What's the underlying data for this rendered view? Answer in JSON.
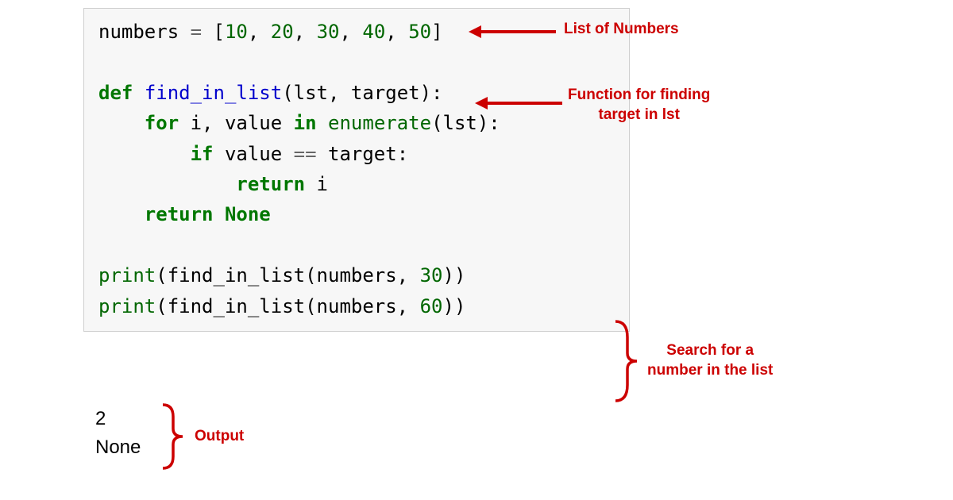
{
  "code": {
    "l1_var": "numbers ",
    "l1_eq": "= ",
    "l1_br_open": "[",
    "l1_n1": "10",
    "l1_c1": ", ",
    "l1_n2": "20",
    "l1_c2": ", ",
    "l1_n3": "30",
    "l1_c3": ", ",
    "l1_n4": "40",
    "l1_c4": ", ",
    "l1_n5": "50",
    "l1_br_close": "]",
    "l2_blank": "",
    "l3_def": "def",
    "l3_sp": " ",
    "l3_name": "find_in_list",
    "l3_sig": "(lst, target):",
    "l4_indent": "    ",
    "l4_for": "for",
    "l4_mid": " i, value ",
    "l4_in": "in",
    "l4_sp": " ",
    "l4_enum": "enumerate",
    "l4_args": "(lst):",
    "l5_indent": "        ",
    "l5_if": "if",
    "l5_mid": " value ",
    "l5_eq": "==",
    "l5_rest": " target:",
    "l6_indent": "            ",
    "l6_return": "return",
    "l6_rest": " i",
    "l7_indent": "    ",
    "l7_return": "return",
    "l7_sp": " ",
    "l7_none": "None",
    "l8_blank": "",
    "l9_print": "print",
    "l9_open": "(find_in_list(numbers, ",
    "l9_num": "30",
    "l9_close": "))",
    "l10_print": "print",
    "l10_open": "(find_in_list(numbers, ",
    "l10_num": "60",
    "l10_close": "))"
  },
  "output": {
    "line1": "2",
    "line2": "None"
  },
  "annotations": {
    "list": "List of Numbers",
    "func": "Function for finding\ntarget in lst",
    "search": "Search for a\nnumber in the list",
    "output": "Output"
  }
}
